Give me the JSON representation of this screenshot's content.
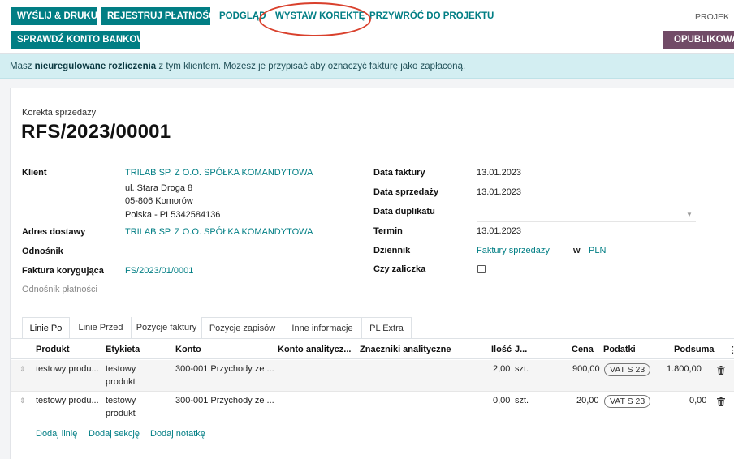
{
  "toolbar": {
    "send_print": "WYŚLIJ & DRUKUJ",
    "register_payment": "REJESTRUJ PŁATNOŚĆ",
    "preview": "PODGLĄD",
    "credit_note": "WYSTAW KOREKTĘ",
    "reset_draft": "PRZYWRÓĆ DO PROJEKTU",
    "check_bank": "SPRAWDŹ KONTO BANKOWE"
  },
  "status": {
    "draft": "PROJEK",
    "posted": "OPUBLIKOWANO"
  },
  "alert": {
    "part1": "Masz ",
    "bold": "nieuregulowane rozliczenia",
    "part2": " z tym klientem. Możesz je przypisać aby oznaczyć fakturę jako zapłaconą."
  },
  "document": {
    "subtitle": "Korekta sprzedaży",
    "number": "RFS/2023/00001"
  },
  "fields_left": {
    "client_label": "Klient",
    "client_name": "TRILAB SP. Z O.O. SPÓŁKA KOMANDYTOWA",
    "address_line1": "ul. Stara Droga 8",
    "address_line2": "05-806 Komorów",
    "address_line3": "Polska - PL5342584136",
    "delivery_label": "Adres dostawy",
    "delivery_value": "TRILAB SP. Z O.O. SPÓŁKA KOMANDYTOWA",
    "reference_label": "Odnośnik",
    "corrected_label": "Faktura korygująca",
    "corrected_value": "FS/2023/01/0001",
    "payment_ref_label": "Odnośnik płatności"
  },
  "fields_right": {
    "invoice_date_label": "Data faktury",
    "invoice_date_value": "13.01.2023",
    "sale_date_label": "Data sprzedaży",
    "sale_date_value": "13.01.2023",
    "duplicate_date_label": "Data duplikatu",
    "due_label": "Termin",
    "due_value": "13.01.2023",
    "journal_label": "Dziennik",
    "journal_value": "Faktury sprzedaży",
    "in_word": "w",
    "currency": "PLN",
    "advance_label": "Czy zaliczka"
  },
  "tabs": [
    "Linie Po",
    "Linie Przed",
    "Pozycje faktury",
    "Pozycje zapisów",
    "Inne informacje",
    "PL Extra"
  ],
  "table": {
    "headers": {
      "product": "Produkt",
      "label": "Etykieta",
      "account": "Konto",
      "analytic_account": "Konto analitycz...",
      "analytic_tags": "Znaczniki analityczne",
      "qty": "Ilość",
      "uom": "J...",
      "price": "Cena",
      "taxes": "Podatki",
      "subtotal": "Podsuma"
    },
    "rows": [
      {
        "product": "testowy produ...",
        "label_1": "testowy",
        "label_2": "produkt",
        "account": "300-001 Przychody ze ...",
        "qty": "2,00",
        "uom": "szt.",
        "price": "900,00",
        "tax": "VAT S 23",
        "subtotal": "1.800,00"
      },
      {
        "product": "testowy produ...",
        "label_1": "testowy",
        "label_2": "produkt",
        "account": "300-001 Przychody ze ...",
        "qty": "0,00",
        "uom": "szt.",
        "price": "20,00",
        "tax": "VAT S 23",
        "subtotal": "0,00"
      }
    ],
    "add_line": "Dodaj linię",
    "add_section": "Dodaj sekcję",
    "add_note": "Dodaj notatkę"
  },
  "colors": {
    "primary": "#017e84",
    "posted": "#714b67",
    "alert_bg": "#d3eef2",
    "annotation": "#d9402c"
  }
}
